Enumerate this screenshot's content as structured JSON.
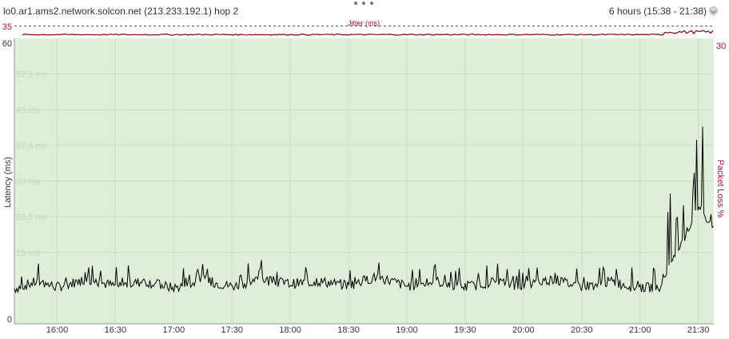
{
  "header": {
    "title": "lo0.ar1.ams2.network.solcon.net (213.233.192.1) hop 2",
    "time_range": "6 hours (15:38 - 21:38)"
  },
  "colors": {
    "plot_bg": "#dfeed8",
    "latency_line": "#000000",
    "jitter_line": "#800000",
    "loss_axis": "#b0123c"
  },
  "jitter_chart": {
    "title": "Jitter (ms)",
    "y_max_label": "35",
    "right_label": "30"
  },
  "chart_data": {
    "type": "line",
    "title": "",
    "ylabel": "Latency (ms)",
    "y2label": "Packet Loss %",
    "ylim": [
      0,
      60
    ],
    "y2_max_label": "30",
    "y_ticks": [
      "0",
      "15 ms",
      "22,5 ms",
      "30 ms",
      "37,5 ms",
      "45 ms",
      "52,5 ms",
      "60"
    ],
    "x_ticks": [
      "16:00",
      "16:30",
      "17:00",
      "17:30",
      "18:00",
      "18:30",
      "19:00",
      "19:30",
      "20:00",
      "20:30",
      "21:00",
      "21:30"
    ],
    "grid": true,
    "series": [
      {
        "x": [
          "15:38",
          "15:50",
          "16:00",
          "16:15",
          "16:30",
          "16:45",
          "17:00",
          "17:15",
          "17:30",
          "17:45",
          "18:00",
          "18:15",
          "18:30",
          "18:45",
          "19:00",
          "19:15",
          "19:30",
          "19:45",
          "20:00",
          "20:15",
          "20:30",
          "20:45",
          "21:00",
          "21:10",
          "21:15",
          "21:20",
          "21:25",
          "21:30",
          "21:35",
          "21:38"
        ],
        "values": [
          7.5,
          9,
          7.8,
          9.5,
          8,
          9,
          7.6,
          9.2,
          8,
          9.5,
          8.5,
          9,
          8.2,
          10,
          8,
          9,
          7.8,
          9,
          8,
          9.5,
          7.8,
          9,
          7.5,
          8,
          12,
          15,
          20,
          25,
          22,
          20
        ]
      }
    ]
  }
}
